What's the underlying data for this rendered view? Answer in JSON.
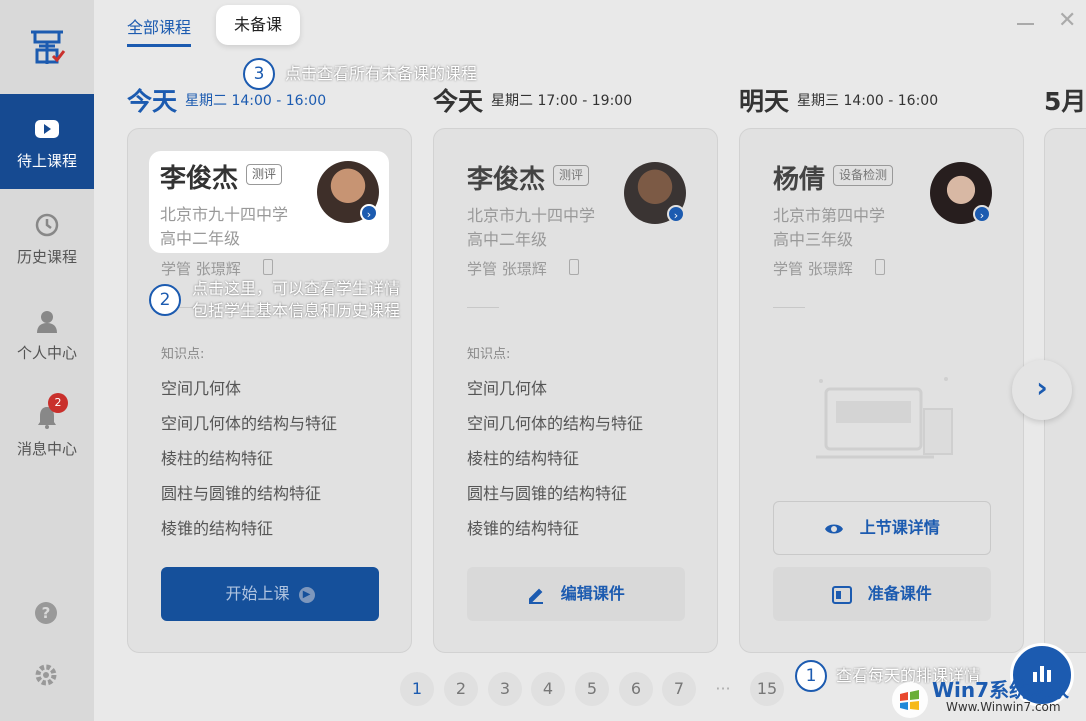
{
  "sidebar": {
    "items": [
      {
        "label": "待上课程",
        "icon": "play-video-icon"
      },
      {
        "label": "历史课程",
        "icon": "history-clock-icon"
      },
      {
        "label": "个人中心",
        "icon": "user-icon"
      },
      {
        "label": "消息中心",
        "icon": "bell-icon",
        "badge": "2"
      }
    ]
  },
  "tabs": {
    "all": "全部课程",
    "pending": "未备课"
  },
  "days": [
    {
      "day": "今天",
      "time": "星期二  14:00 - 16:00"
    },
    {
      "day": "今天",
      "time": "星期二  17:00 - 19:00"
    },
    {
      "day": "明天",
      "time": "星期三  14:00 - 16:00"
    },
    {
      "day": "5月"
    }
  ],
  "cards": [
    {
      "name": "李俊杰",
      "tag": "测评",
      "school": "北京市九十四中学",
      "grade": "高中二年级",
      "manager": "学管 张璟辉",
      "kp_title": "知识点:",
      "knowledge": [
        "空间几何体",
        "空间几何体的结构与特征",
        "棱柱的结构特征",
        "圆柱与圆锥的结构特征",
        "棱锥的结构特征"
      ],
      "button": "开始上课"
    },
    {
      "name": "李俊杰",
      "tag": "测评",
      "school": "北京市九十四中学",
      "grade": "高中二年级",
      "manager": "学管 张璟辉",
      "kp_title": "知识点:",
      "knowledge": [
        "空间几何体",
        "空间几何体的结构与特征",
        "棱柱的结构特征",
        "圆柱与圆锥的结构特征",
        "棱锥的结构特征"
      ],
      "button": "编辑课件"
    },
    {
      "name": "杨倩",
      "tag": "设备检测",
      "school": "北京市第四中学",
      "grade": "高中三年级",
      "manager": "学管 张璟辉",
      "detail_button": "上节课详情",
      "button": "准备课件"
    }
  ],
  "pagination": [
    "1",
    "2",
    "3",
    "4",
    "5",
    "6",
    "7",
    "···",
    "15"
  ],
  "tour": [
    {
      "num": "1",
      "text": "查看每天的排课详情"
    },
    {
      "num": "2",
      "line1": "点击这里，可以查看学生详情",
      "line2": "包括学生基本信息和历史课程"
    },
    {
      "num": "3",
      "text": "点击查看所有未备课的课程"
    }
  ],
  "watermark": {
    "line1": "Win7系统之家",
    "line2": "Www.Winwin7.com"
  },
  "colors": {
    "primary": "#1c5bb0",
    "sidebar_active": "#164a91",
    "badge": "#c9302c"
  }
}
